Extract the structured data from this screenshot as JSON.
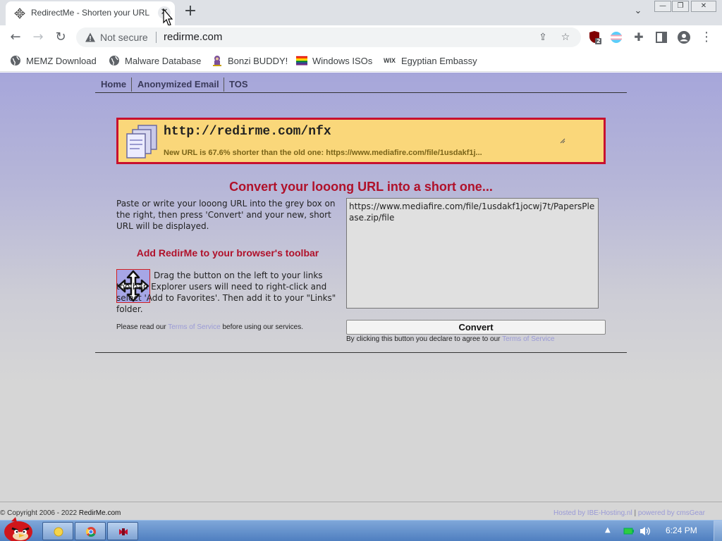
{
  "browser": {
    "tab_title": "RedirectMe - Shorten your URL",
    "tab_close": "✕",
    "new_tab": "+",
    "tab_search": "⌄",
    "window_controls": {
      "minimize": "—",
      "restore": "❐",
      "close": "✕"
    },
    "security_label": "Not secure",
    "url": "redirme.com",
    "extension_badge": "2",
    "bookmarks": [
      {
        "label": "MEMZ Download",
        "icon": "globe-icon"
      },
      {
        "label": "Malware Database",
        "icon": "globe-icon"
      },
      {
        "label": "Bonzi BUDDY!",
        "icon": "bonzi-icon"
      },
      {
        "label": "Windows ISOs",
        "icon": "rainbow-flag-icon"
      },
      {
        "label": "Egyptian Embassy",
        "icon": "wix-icon"
      }
    ],
    "wix_text": "WIX"
  },
  "site": {
    "nav": [
      "Home",
      "Anonymized Email",
      "TOS"
    ],
    "result": {
      "short_url": "http://redirme.com/nfx",
      "note": "New URL is 67.6% shorter than the old one: https://www.mediafire.com/file/1usdakf1j..."
    },
    "headline": "Convert your looong URL into a short one...",
    "instructions": "Paste or write your looong URL into the grey box on the right, then press 'Convert' and your new, short URL will be displayed.",
    "toolbar_heading": "Add RedirMe to your browser's toolbar",
    "drag_text": "Drag the button on the left to your links toolbar. Explorer users will need to right-click and select 'Add to Favorites'. Then add it to your \"Links\" folder.",
    "tos_note_prefix": "Please read our",
    "tos_link": "Terms of Service",
    "tos_note_suffix": "before using our services.",
    "long_url": "https://www.mediafire.com/file/1usdakf1jocwj7t/PapersPlease.zip/file",
    "convert_label": "Convert",
    "agree_prefix": "By clicking this button you declare to agree to our",
    "agree_link": "Terms of Service",
    "copyright_prefix": "© Copyright 2006 - 2022",
    "copyright_brand": "RedirMe.com",
    "hosted": "Hosted by IBE-Hosting.nl",
    "hosted_sep": "|",
    "powered": "powered by cmsGear"
  },
  "taskbar": {
    "clock": "6:24 PM"
  },
  "colors": {
    "accent_red": "#c8102e",
    "result_bg": "#fad77a",
    "link_lavender": "#9a9ad6"
  }
}
